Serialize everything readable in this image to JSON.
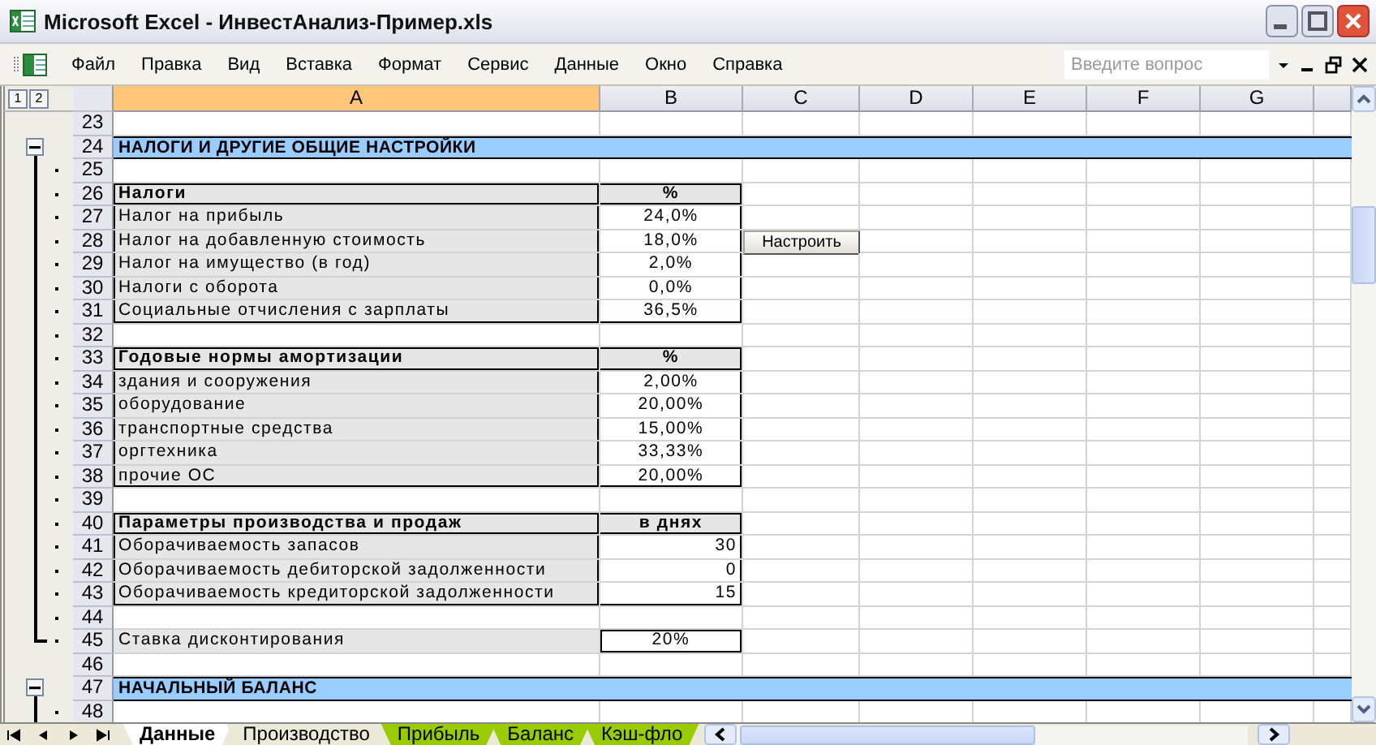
{
  "window": {
    "title": "Microsoft Excel - ИнвестАнализ-Пример.xls"
  },
  "menu": [
    "Файл",
    "Правка",
    "Вид",
    "Вставка",
    "Формат",
    "Сервис",
    "Данные",
    "Окно",
    "Справка"
  ],
  "help_search": {
    "placeholder": "Введите вопрос"
  },
  "outline_levels": [
    "1",
    "2"
  ],
  "columns": [
    {
      "label": "A",
      "selected": true
    },
    {
      "label": "B",
      "selected": false
    },
    {
      "label": "C",
      "selected": false
    },
    {
      "label": "D",
      "selected": false
    },
    {
      "label": "E",
      "selected": false
    },
    {
      "label": "F",
      "selected": false
    },
    {
      "label": "G",
      "selected": false
    }
  ],
  "rows": [
    {
      "num": "23",
      "outline": {
        "kind": "none"
      },
      "kind": "blank"
    },
    {
      "num": "24",
      "outline": {
        "kind": "button"
      },
      "kind": "section",
      "label": "НАЛОГИ И ДРУГИЕ ОБЩИЕ НАСТРОЙКИ"
    },
    {
      "num": "25",
      "outline": {
        "kind": "dot"
      },
      "kind": "blank"
    },
    {
      "num": "26",
      "outline": {
        "kind": "dot"
      },
      "kind": "header",
      "label": "Налоги",
      "value": "%"
    },
    {
      "num": "27",
      "outline": {
        "kind": "dot"
      },
      "kind": "item",
      "label": "Налог на прибыль",
      "value": "24,0%"
    },
    {
      "num": "28",
      "outline": {
        "kind": "dot"
      },
      "kind": "item",
      "label": "Налог на добавленную стоимость",
      "value": "18,0%",
      "button": "Настроить"
    },
    {
      "num": "29",
      "outline": {
        "kind": "dot"
      },
      "kind": "item",
      "label": "Налог на имущество (в год)",
      "value": "2,0%"
    },
    {
      "num": "30",
      "outline": {
        "kind": "dot"
      },
      "kind": "item",
      "label": "Налоги с оборота",
      "value": "0,0%"
    },
    {
      "num": "31",
      "outline": {
        "kind": "dot"
      },
      "kind": "item",
      "label": "Социальные отчисления с зарплаты",
      "value": "36,5%"
    },
    {
      "num": "32",
      "outline": {
        "kind": "dot"
      },
      "kind": "blank"
    },
    {
      "num": "33",
      "outline": {
        "kind": "dot"
      },
      "kind": "header",
      "label": "Годовые нормы амортизации",
      "value": "%"
    },
    {
      "num": "34",
      "outline": {
        "kind": "dot"
      },
      "kind": "item",
      "label": "здания и сооружения",
      "value": "2,00%"
    },
    {
      "num": "35",
      "outline": {
        "kind": "dot"
      },
      "kind": "item",
      "label": "оборудование",
      "value": "20,00%"
    },
    {
      "num": "36",
      "outline": {
        "kind": "dot"
      },
      "kind": "item",
      "label": "транспортные средства",
      "value": "15,00%"
    },
    {
      "num": "37",
      "outline": {
        "kind": "dot"
      },
      "kind": "item",
      "label": "оргтехника",
      "value": "33,33%"
    },
    {
      "num": "38",
      "outline": {
        "kind": "dot"
      },
      "kind": "item",
      "label": "прочие ОС",
      "value": "20,00%"
    },
    {
      "num": "39",
      "outline": {
        "kind": "dot"
      },
      "kind": "blank"
    },
    {
      "num": "40",
      "outline": {
        "kind": "dot"
      },
      "kind": "header",
      "label": "Параметры производства и продаж",
      "value": "в днях"
    },
    {
      "num": "41",
      "outline": {
        "kind": "dot"
      },
      "kind": "count",
      "label": "Оборачиваемость запасов",
      "value": "30"
    },
    {
      "num": "42",
      "outline": {
        "kind": "dot"
      },
      "kind": "count",
      "label": "Оборачиваемость дебиторской задолженности",
      "value": "0"
    },
    {
      "num": "43",
      "outline": {
        "kind": "dot"
      },
      "kind": "count",
      "label": "Оборачиваемость кредиторской задолженности",
      "value": "15"
    },
    {
      "num": "44",
      "outline": {
        "kind": "dot"
      },
      "kind": "blank"
    },
    {
      "num": "45",
      "outline": {
        "kind": "end"
      },
      "kind": "single",
      "label": "Ставка дисконтирования",
      "value": "20%"
    },
    {
      "num": "46",
      "outline": {
        "kind": "none"
      },
      "kind": "blank"
    },
    {
      "num": "47",
      "outline": {
        "kind": "button"
      },
      "kind": "section",
      "label": "НАЧАЛЬНЫЙ БАЛАНС"
    },
    {
      "num": "48",
      "outline": {
        "kind": "dot"
      },
      "kind": "blank"
    }
  ],
  "sheet_tabs": [
    {
      "label": "Данные",
      "selected": true,
      "color": "#ffffff"
    },
    {
      "label": "Производство",
      "selected": false,
      "color": "#ece9d8"
    },
    {
      "label": "Прибыль",
      "selected": false,
      "color": "#99cc00"
    },
    {
      "label": "Баланс",
      "selected": false,
      "color": "#99cc00"
    },
    {
      "label": "Кэш-фло",
      "selected": false,
      "color": "#99cc00"
    }
  ]
}
